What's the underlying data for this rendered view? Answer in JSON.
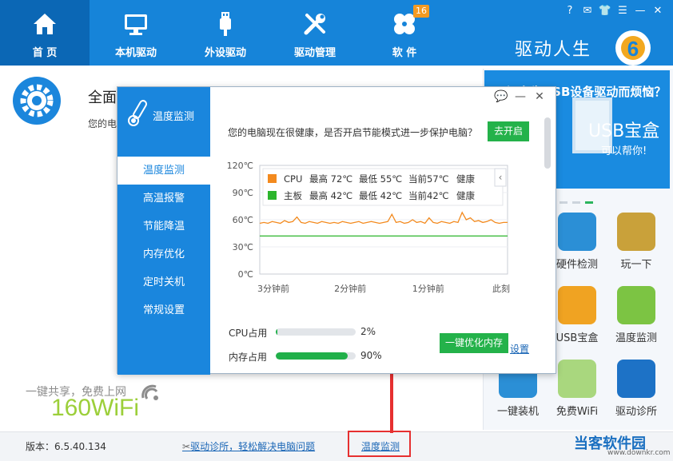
{
  "nav": {
    "items": [
      {
        "label": "首 页",
        "icon": "home-icon"
      },
      {
        "label": "本机驱动",
        "icon": "monitor-icon"
      },
      {
        "label": "外设驱动",
        "icon": "usb-icon"
      },
      {
        "label": "驱动管理",
        "icon": "tools-icon"
      },
      {
        "label": "软 件",
        "icon": "apps-icon"
      }
    ],
    "badge": "16",
    "brand": "驱动人生"
  },
  "home": {
    "title": "全面",
    "subtitle": "您的电"
  },
  "wifi": {
    "slogan": "一键共享，免费上网",
    "logo": "160WiFi"
  },
  "ad": {
    "top": "还在为USB设备驱动而烦恼？",
    "big": "USB宝盒",
    "help": "可以帮你!"
  },
  "tools": [
    {
      "label": "硬件检测"
    },
    {
      "label": "玩一下"
    },
    {
      "label": "USB宝盒"
    },
    {
      "label": "温度监测"
    },
    {
      "label": "一键装机"
    },
    {
      "label": "免费WiFi"
    },
    {
      "label": "驱动诊所"
    }
  ],
  "status": {
    "version": "版本：6.5.40.134",
    "diag_link": "驱动诊所，轻松解决电脑问题",
    "temp_link": "温度监测",
    "site": "当客软件园",
    "site_url": "www.downkr.com"
  },
  "dialog": {
    "title": "温度监测",
    "menu": [
      "温度监测",
      "高温报警",
      "节能降温",
      "内存优化",
      "定时关机",
      "常规设置"
    ],
    "health_msg": "您的电脑现在很健康，是否开启节能模式进一步保护电脑？",
    "go_button": "去开启",
    "cpu_label": "CPU占用",
    "mem_label": "内存占用",
    "cpu_pct_text": "2%",
    "mem_pct_text": "90%",
    "optimize_button": "一键优化内存",
    "settings_link": "设置"
  },
  "usage": {
    "cpu": 0.02,
    "mem": 0.9
  },
  "colors": {
    "primary_blue": "#1684d9",
    "green": "#24b24a",
    "orange": "#f38a1e",
    "red_highlight": "#e63030"
  },
  "chart_data": {
    "type": "line",
    "ylim": [
      0,
      120
    ],
    "yticks": [
      "0℃",
      "30℃",
      "60℃",
      "90℃",
      "120℃"
    ],
    "xticks": [
      "3分钟前",
      "2分钟前",
      "1分钟前",
      "此刻"
    ],
    "legend": [
      {
        "name": "CPU",
        "color": "#f38a1e",
        "high": "最高 72℃",
        "low": "最低 55℃",
        "current": "当前57℃",
        "state": "健康"
      },
      {
        "name": "主板",
        "color": "#2cb52c",
        "high": "最高 42℃",
        "low": "最低 42℃",
        "current": "当前42℃",
        "state": "健康"
      }
    ],
    "series": [
      {
        "name": "CPU",
        "color": "#f38a1e",
        "values": [
          56,
          57,
          56,
          58,
          57,
          56,
          59,
          57,
          58,
          63,
          57,
          56,
          58,
          57,
          56,
          58,
          57,
          56,
          57,
          56,
          58,
          57,
          56,
          57,
          58,
          56,
          57,
          58,
          57,
          56,
          57,
          58,
          66,
          57,
          58,
          56,
          57,
          60,
          57,
          58,
          56,
          62,
          57,
          56,
          58,
          57,
          56,
          58,
          57,
          68,
          60,
          62,
          58,
          59,
          57,
          58,
          60,
          57,
          56,
          57,
          57
        ]
      },
      {
        "name": "主板",
        "color": "#2cb52c",
        "values": [
          42,
          42,
          42,
          42,
          42,
          42,
          42,
          42,
          42,
          42,
          42,
          42,
          42,
          42,
          42,
          42,
          42,
          42,
          42,
          42,
          42,
          42,
          42,
          42,
          42,
          42,
          42,
          42,
          42,
          42,
          42,
          42,
          42,
          42,
          42,
          42,
          42,
          42,
          42,
          42,
          42,
          42,
          42,
          42,
          42,
          42,
          42,
          42,
          42,
          42,
          42,
          42,
          42,
          42,
          42,
          42,
          42,
          42,
          42,
          42,
          42
        ]
      }
    ]
  }
}
